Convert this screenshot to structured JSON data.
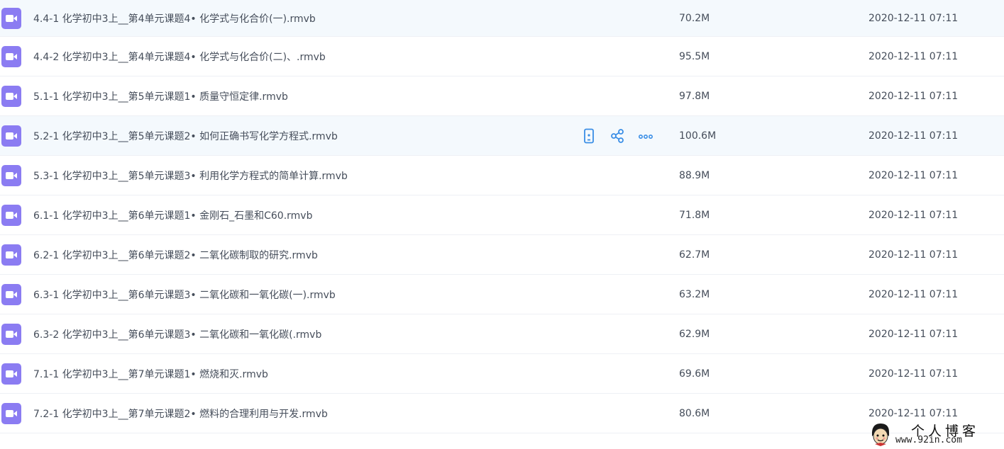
{
  "files": [
    {
      "name": "4.4-1 化学初中3上__第4单元课题4• 化学式与化合价(一).rmvb",
      "size": "70.2M",
      "date": "2020-12-11 07:11",
      "highlighted": true,
      "hovered": false
    },
    {
      "name": "4.4-2 化学初中3上__第4单元课题4• 化学式与化合价(二)、.rmvb",
      "size": "95.5M",
      "date": "2020-12-11 07:11",
      "highlighted": false,
      "hovered": false
    },
    {
      "name": "5.1-1 化学初中3上__第5单元课题1• 质量守恒定律.rmvb",
      "size": "97.8M",
      "date": "2020-12-11 07:11",
      "highlighted": false,
      "hovered": false
    },
    {
      "name": "5.2-1 化学初中3上__第5单元课题2• 如何正确书写化学方程式.rmvb",
      "size": "100.6M",
      "date": "2020-12-11 07:11",
      "highlighted": false,
      "hovered": true
    },
    {
      "name": "5.3-1 化学初中3上__第5单元课题3• 利用化学方程式的简单计算.rmvb",
      "size": "88.9M",
      "date": "2020-12-11 07:11",
      "highlighted": false,
      "hovered": false
    },
    {
      "name": "6.1-1 化学初中3上__第6单元课题1• 金刚石_石墨和C60.rmvb",
      "size": "71.8M",
      "date": "2020-12-11 07:11",
      "highlighted": false,
      "hovered": false
    },
    {
      "name": "6.2-1 化学初中3上__第6单元课题2• 二氧化碳制取的研究.rmvb",
      "size": "62.7M",
      "date": "2020-12-11 07:11",
      "highlighted": false,
      "hovered": false
    },
    {
      "name": "6.3-1 化学初中3上__第6单元课题3• 二氧化碳和一氧化碳(一).rmvb",
      "size": "63.2M",
      "date": "2020-12-11 07:11",
      "highlighted": false,
      "hovered": false
    },
    {
      "name": "6.3-2 化学初中3上__第6单元课题3• 二氧化碳和一氧化碳(.rmvb",
      "size": "62.9M",
      "date": "2020-12-11 07:11",
      "highlighted": false,
      "hovered": false
    },
    {
      "name": "7.1-1 化学初中3上__第7单元课题1• 燃烧和灭.rmvb",
      "size": "69.6M",
      "date": "2020-12-11 07:11",
      "highlighted": false,
      "hovered": false
    },
    {
      "name": "7.2-1 化学初中3上__第7单元课题2• 燃料的合理利用与开发.rmvb",
      "size": "80.6M",
      "date": "2020-12-11 07:11",
      "highlighted": false,
      "hovered": false
    }
  ],
  "file_icon": "video-file-icon",
  "row_actions": [
    "phone-icon",
    "share-icon",
    "more-icon"
  ],
  "colors": {
    "video_icon": "#8b7cf2",
    "action_icon": "#3a8ee6",
    "highlight_row": "#f4f9fd",
    "text": "#454d5a"
  },
  "watermark": {
    "title": "个人博客",
    "url": "www.92in.com"
  }
}
